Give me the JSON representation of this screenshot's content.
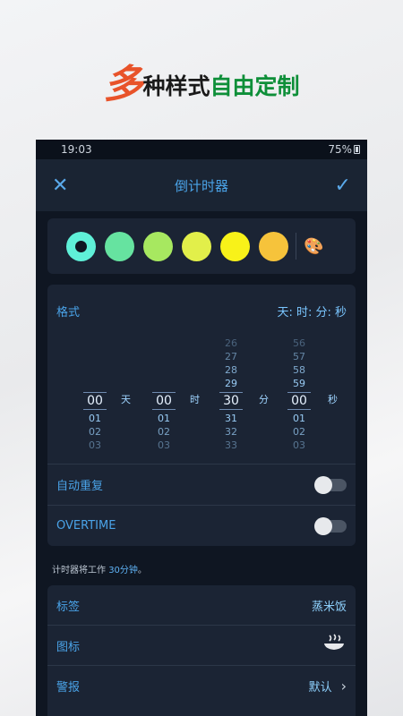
{
  "promo": {
    "big": "多",
    "dark": "种样式",
    "green": "自由定制"
  },
  "status": {
    "time": "19:03",
    "battery": "75%"
  },
  "appbar": {
    "title": "倒计时器",
    "close_icon": "close-icon",
    "confirm_icon": "check-icon"
  },
  "colors": {
    "swatches": [
      "#5ff0d8",
      "#66e3a0",
      "#a7e860",
      "#e2ef4a",
      "#f8f219",
      "#f6c33b"
    ],
    "selected_index": 0,
    "palette_icon": "palette-icon"
  },
  "format": {
    "label": "格式",
    "value": "天: 时: 分: 秒",
    "columns": [
      {
        "unit": "天",
        "above": [],
        "selected": "00",
        "below": [
          "01",
          "02",
          "03"
        ]
      },
      {
        "unit": "时",
        "above": [],
        "selected": "00",
        "below": [
          "01",
          "02",
          "03"
        ]
      },
      {
        "unit": "分",
        "above": [
          "26",
          "27",
          "28",
          "29"
        ],
        "selected": "30",
        "below": [
          "31",
          "32",
          "33"
        ]
      },
      {
        "unit": "秒",
        "above": [
          "56",
          "57",
          "58",
          "59"
        ],
        "selected": "00",
        "below": [
          "01",
          "02",
          "03"
        ]
      }
    ]
  },
  "settings": {
    "auto_repeat": {
      "label": "自动重复",
      "on": false
    },
    "overtime": {
      "label": "OVERTIME",
      "on": false
    }
  },
  "note": {
    "prefix": "计时器将工作 ",
    "highlight": "30分钟",
    "suffix": "。"
  },
  "meta": {
    "tag": {
      "label": "标签",
      "value": "蒸米饭"
    },
    "icon": {
      "label": "图标",
      "icon": "rice-bowl-icon"
    },
    "alarm": {
      "label": "警报",
      "value": "默认"
    }
  }
}
